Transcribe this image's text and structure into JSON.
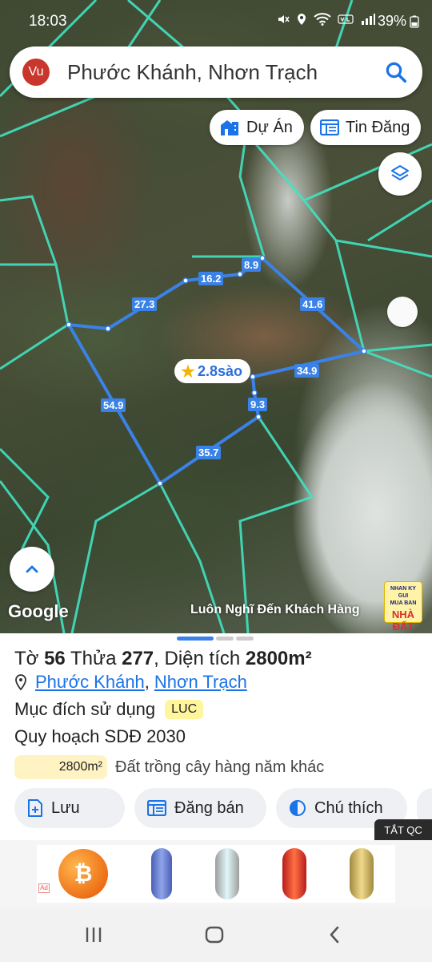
{
  "status_bar": {
    "time": "18:03",
    "battery": "39%"
  },
  "search": {
    "avatar_text": "Vu",
    "query": "Phước Khánh, Nhơn Trạch"
  },
  "chips": {
    "du_an": "Dự Án",
    "tin_dang": "Tin Đăng"
  },
  "map": {
    "area_label": "2.8sào",
    "dimensions": {
      "d1": "27.3",
      "d2": "16.2",
      "d3": "8.9",
      "d4": "41.6",
      "d5": "34.9",
      "d6": "9.3",
      "d7": "35.7",
      "d8": "54.9"
    },
    "google": "Google",
    "tagline": "Luôn Nghĩ Đến Khách Hàng",
    "brand": {
      "line1": "NHAN KY GUI",
      "line2": "MUA BAN",
      "line3": "NHÀ ĐẤT"
    }
  },
  "sheet": {
    "to_label": "Tờ",
    "to_value": "56",
    "thua_label": "Thửa",
    "thua_value": "277",
    "dien_tich_label": "Diện tích",
    "dien_tich_value": "2800m²",
    "ward": "Phước Khánh",
    "district": "Nhơn Trạch",
    "purpose_label": "Mục đích sử dụng",
    "purpose_code": "LUC",
    "planning": "Quy hoạch SDĐ 2030",
    "plan_area": "2800m²",
    "plan_type": "Đất trồng cây hàng năm khác",
    "actions": {
      "save": "Lưu",
      "post": "Đăng bán",
      "legend": "Chú thích"
    }
  },
  "ad": {
    "close_label": "TẮT QC",
    "ad_mark": "Ad"
  },
  "colors": {
    "accent": "#1a73e8",
    "parcel_line": "#3b82e6",
    "boundary": "#41e3c2",
    "badge": "#fff59d"
  }
}
